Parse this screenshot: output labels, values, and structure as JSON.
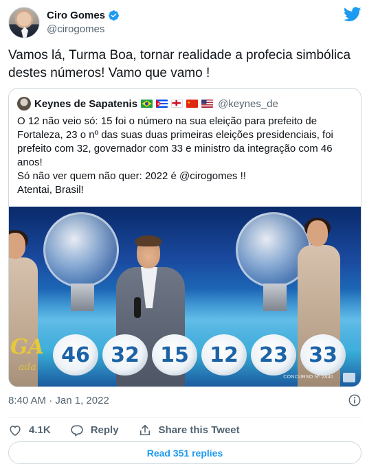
{
  "author": {
    "display_name": "Ciro Gomes",
    "handle": "@cirogomes",
    "verified": true
  },
  "tweet_text": "Vamos lá, Turma Boa, tornar realidade a profecia simbólica destes números! Vamo que vamo !",
  "quote": {
    "display_name": "Keynes de Sapatenis",
    "handle": "@keynes_de",
    "flags": [
      "brazil",
      "cuba",
      "england",
      "china",
      "usa"
    ],
    "lines": [
      "O 12 não veio só: 15 foi o número na sua eleição para prefeito de Fortaleza, 23 o nº das suas duas primeiras eleições presidenciais, foi prefeito com 32, governador com 33 e ministro da integração com 46 anos!",
      "Só não ver quem não quer: 2022 é @cirogomes !!",
      "Atentai, Brasil!"
    ],
    "media": {
      "balls": [
        "46",
        "32",
        "15",
        "12",
        "23",
        "33"
      ],
      "logo_text": "GA",
      "logo_sub": "ada",
      "overlay_text": "CONCURSO Nº 2440"
    }
  },
  "meta": {
    "time": "8:40 AM",
    "separator": " · ",
    "date": "Jan 1, 2022"
  },
  "actions": {
    "like_count": "4.1K",
    "reply_label": "Reply",
    "share_label": "Share this Tweet"
  },
  "read_replies_label": "Read 351 replies",
  "colors": {
    "accent": "#1d9bf0",
    "text": "#0f1419",
    "secondary": "#536471",
    "border": "#cfd9de"
  },
  "icons": [
    "verified-badge-icon",
    "twitter-bird-icon",
    "info-icon",
    "heart-icon",
    "reply-icon",
    "share-icon"
  ]
}
